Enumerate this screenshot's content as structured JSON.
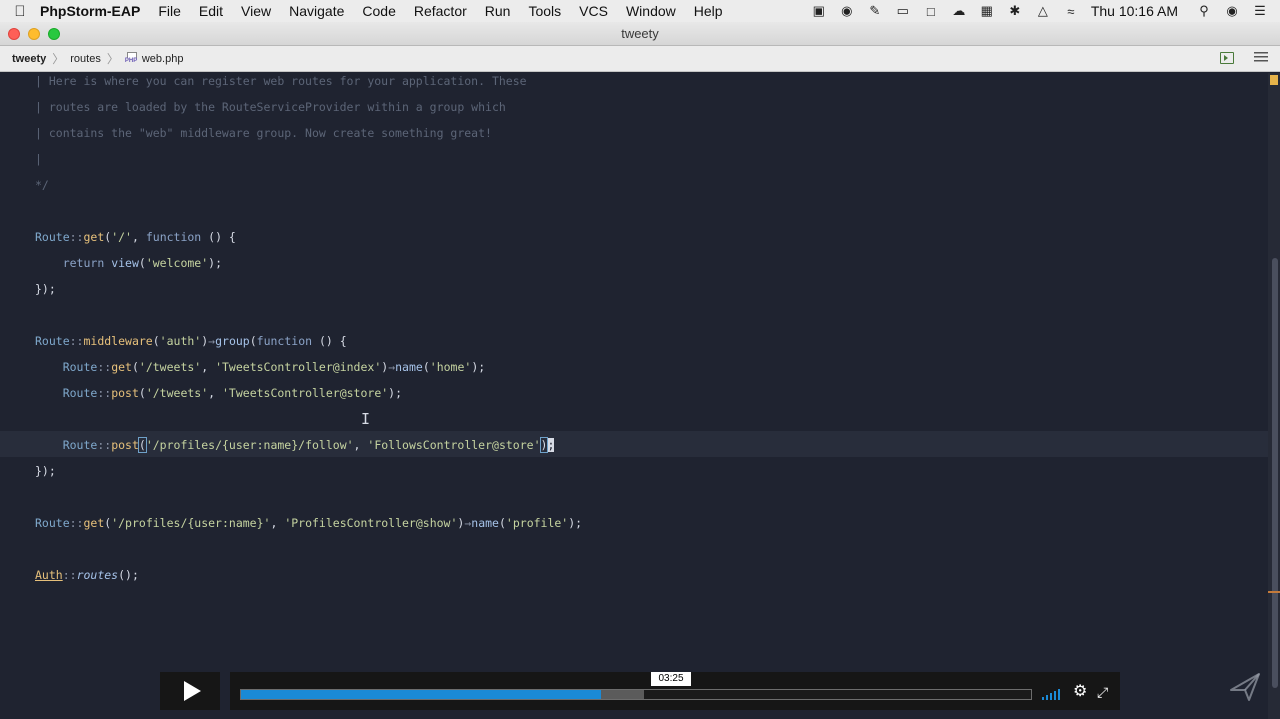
{
  "menubar": {
    "app_name": "PhpStorm-EAP",
    "menus": [
      "File",
      "Edit",
      "View",
      "Navigate",
      "Code",
      "Refactor",
      "Run",
      "Tools",
      "VCS",
      "Window",
      "Help"
    ],
    "clock": "Thu 10:16 AM",
    "tray_icons": [
      "screen-record-icon",
      "onepassword-icon",
      "pen-icon",
      "display-icon",
      "square-icon",
      "cloud-icon",
      "grid-icon",
      "bluetooth-icon",
      "airplay-icon",
      "wifi-icon"
    ]
  },
  "window": {
    "title": "tweety"
  },
  "breadcrumb": {
    "project": "tweety",
    "folder": "routes",
    "file": "web.php",
    "file_icon_label": "PHP"
  },
  "editor": {
    "comment_lines": [
      "| Here is where you can register web routes for your application. These",
      "| routes are loaded by the RouteServiceProvider within a group which",
      "| contains the \"web\" middleware group. Now create something great!",
      "|",
      "*/"
    ]
  },
  "player": {
    "time": "03:25",
    "played_fraction": 0.456,
    "buffered_fraction": 0.51
  },
  "colors": {
    "editor_bg": "#1f2330",
    "progress_played": "#1a8ad6",
    "current_line": "#282d3b"
  }
}
